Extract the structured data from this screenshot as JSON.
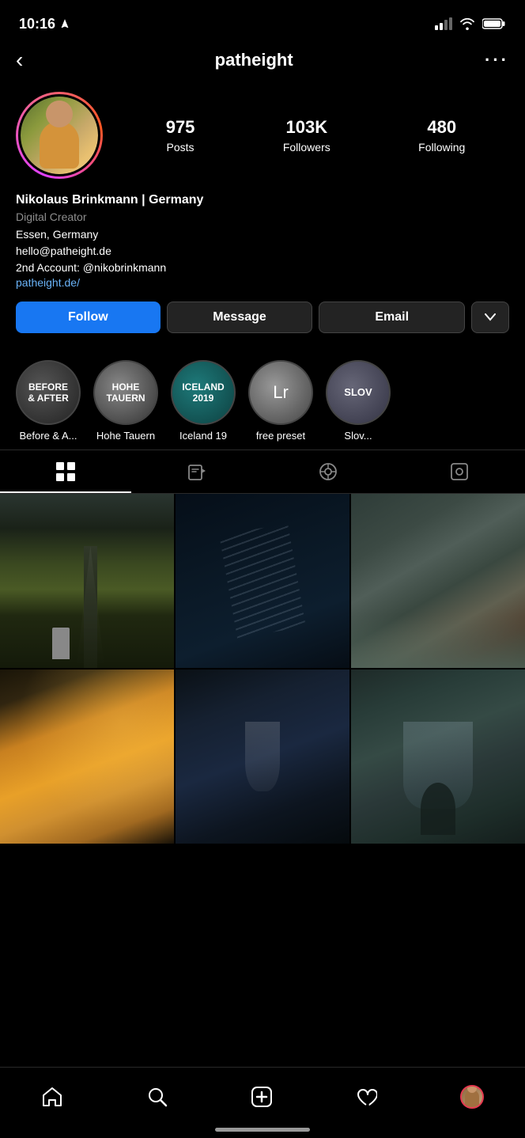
{
  "status_bar": {
    "time": "10:16",
    "location_icon": "location-arrow-icon"
  },
  "header": {
    "back_label": "‹",
    "username": "patheight",
    "more_label": "···"
  },
  "profile": {
    "stats": {
      "posts_count": "975",
      "posts_label": "Posts",
      "followers_count": "103K",
      "followers_label": "Followers",
      "following_count": "480",
      "following_label": "Following"
    },
    "bio": {
      "name": "Nikolaus Brinkmann | Germany",
      "category": "Digital Creator",
      "location": "Essen, Germany",
      "email": "hello@patheight.de",
      "second_account": "2nd Account: @nikobrinkmann",
      "website": "patheight.de/"
    },
    "buttons": {
      "follow": "Follow",
      "message": "Message",
      "email": "Email",
      "dropdown": "▼"
    }
  },
  "highlights": [
    {
      "id": "before-after",
      "label": "Before & A...",
      "text": "BEFORE\n& AFTER",
      "style": "hl-before"
    },
    {
      "id": "hohe-tauern",
      "label": "Hohe Tauern",
      "text": "HOHE\nTAUERN",
      "style": "hl-hohe"
    },
    {
      "id": "iceland-19",
      "label": "Iceland 19",
      "text": "ICELAND\n2019",
      "style": "hl-iceland"
    },
    {
      "id": "free-preset",
      "label": "free preset",
      "text": "Lr",
      "style": "hl-lr"
    },
    {
      "id": "slov",
      "label": "Slov...",
      "text": "SLOV",
      "style": "hl-slov"
    }
  ],
  "tabs": [
    {
      "id": "grid",
      "label": "grid-tab",
      "active": true
    },
    {
      "id": "video",
      "label": "video-tab",
      "active": false
    },
    {
      "id": "reels",
      "label": "reels-tab",
      "active": false
    },
    {
      "id": "tagged",
      "label": "tagged-tab",
      "active": false
    }
  ],
  "photos": [
    {
      "id": "photo-1",
      "style": "photo-1"
    },
    {
      "id": "photo-2",
      "style": "photo-2"
    },
    {
      "id": "photo-3",
      "style": "photo-3"
    },
    {
      "id": "photo-4",
      "style": "photo-4"
    },
    {
      "id": "photo-5",
      "style": "photo-5"
    },
    {
      "id": "photo-6",
      "style": "photo-6"
    }
  ],
  "bottom_nav": {
    "home": "home-icon",
    "search": "search-icon",
    "add": "add-icon",
    "heart": "heart-icon",
    "profile": "profile-icon"
  }
}
